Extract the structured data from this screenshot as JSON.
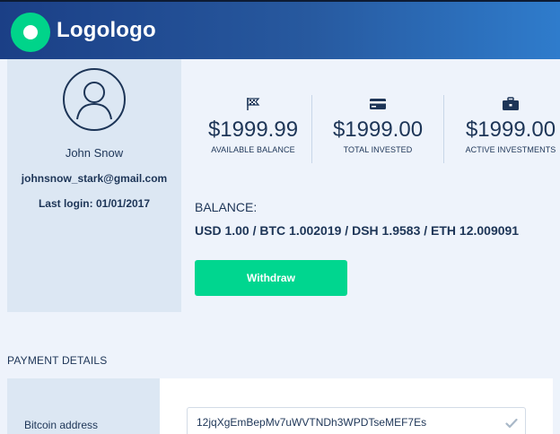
{
  "header": {
    "logo_text": "Logologo",
    "brand_color": "#00d48a"
  },
  "profile": {
    "name": "John Snow",
    "email": "johnsnow_stark@gmail.com",
    "last_login": "Last login:  01/01/2017",
    "avatar_icon": "user-icon"
  },
  "stats": [
    {
      "icon": "flag-icon",
      "amount": "$1999.99",
      "label": "AVAILABLE BALANCE"
    },
    {
      "icon": "credit-card-icon",
      "amount": "$1999.00",
      "label": "TOTAL INVESTED"
    },
    {
      "icon": "briefcase-icon",
      "amount": "$1999.00",
      "label": "ACTIVE INVESTMENTS"
    }
  ],
  "balance": {
    "title": "BALANCE:",
    "values": "USD 1.00 / BTC 1.002019 / DSH 1.9583 / ETH 12.009091"
  },
  "withdraw": {
    "label": "Withdraw",
    "color": "#00d68f"
  },
  "payment": {
    "title": "PAYMENT DETAILS",
    "bitcoin_label": "Bitcoin address",
    "bitcoin_value": "12jqXgEmBepMv7uWVTNDh3WPDTseMEF7Es",
    "check_icon": "check-icon"
  }
}
